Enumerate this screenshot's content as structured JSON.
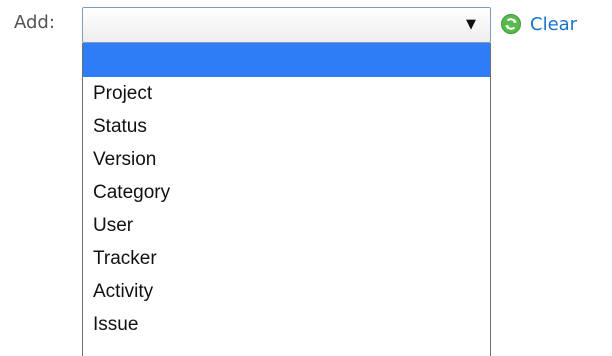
{
  "filter": {
    "label": "Add:",
    "selected_value": "",
    "clear_label": "Clear"
  },
  "dropdown": {
    "options": [
      {
        "label": "",
        "selected": true
      },
      {
        "label": "Project",
        "selected": false
      },
      {
        "label": "Status",
        "selected": false
      },
      {
        "label": "Version",
        "selected": false
      },
      {
        "label": "Category",
        "selected": false
      },
      {
        "label": "User",
        "selected": false
      },
      {
        "label": "Tracker",
        "selected": false
      },
      {
        "label": "Activity",
        "selected": false
      },
      {
        "label": "Issue",
        "selected": false
      }
    ]
  },
  "icons": {
    "dropdown_arrow": "dropdown-arrow-icon",
    "clear": "reload-icon"
  },
  "colors": {
    "link": "#1a73c9",
    "selection": "#2f7df6",
    "icon_green": "#58b94c"
  }
}
